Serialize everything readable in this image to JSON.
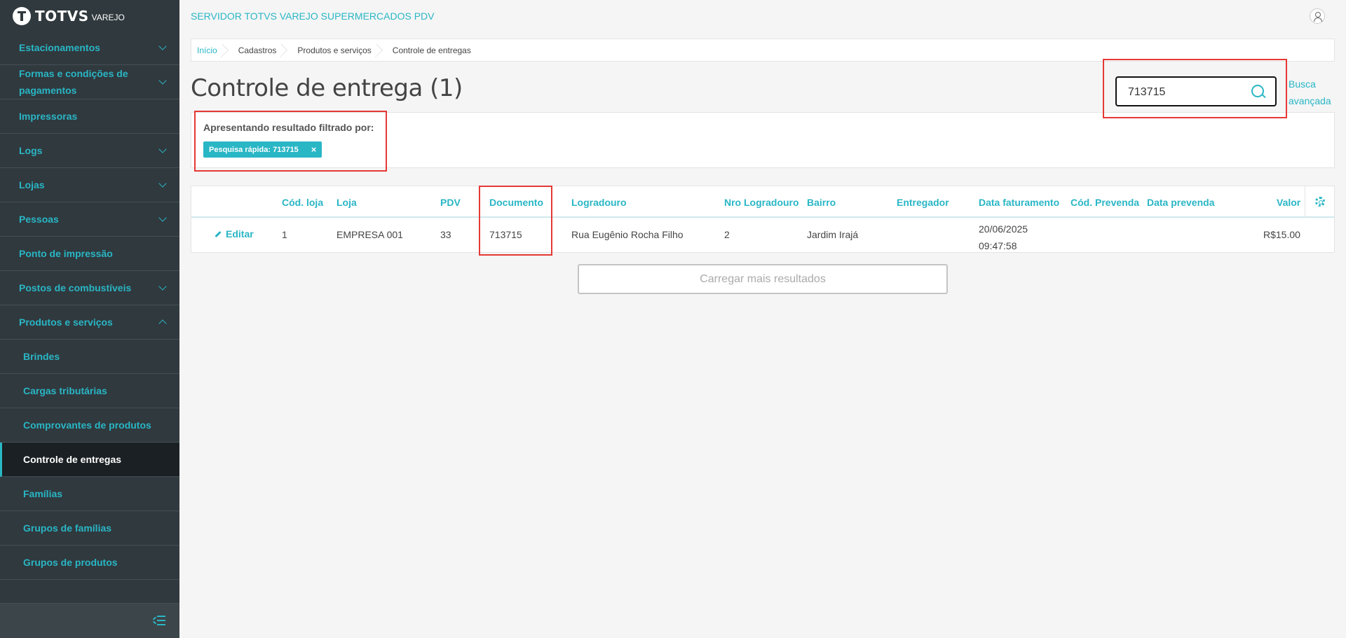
{
  "brand": {
    "name": "TOTVS",
    "sub": "VAREJO"
  },
  "header": {
    "server_title": "SERVIDOR TOTVS VAREJO SUPERMERCADOS PDV"
  },
  "sidebar": {
    "items": [
      {
        "label": "Estacionamentos",
        "expandable": true
      },
      {
        "label": "Formas e condições de pagamentos",
        "line1": "Formas e condições de",
        "line2": "pagamentos",
        "expandable": true
      },
      {
        "label": "Impressoras",
        "expandable": false
      },
      {
        "label": "Logs",
        "expandable": true
      },
      {
        "label": "Lojas",
        "expandable": true
      },
      {
        "label": "Pessoas",
        "expandable": true
      },
      {
        "label": "Ponto de impressão",
        "expandable": false
      },
      {
        "label": "Postos de combustíveis",
        "expandable": true
      },
      {
        "label": "Produtos e serviços",
        "expandable": true,
        "expanded": true
      }
    ],
    "sub_items": [
      {
        "label": "Brindes"
      },
      {
        "label": "Cargas tributárias"
      },
      {
        "label": "Comprovantes de produtos"
      },
      {
        "label": "Controle de entregas",
        "active": true
      },
      {
        "label": "Famílias"
      },
      {
        "label": "Grupos de famílias"
      },
      {
        "label": "Grupos de produtos"
      }
    ]
  },
  "breadcrumb": [
    "Início",
    "Cadastros",
    "Produtos e serviços",
    "Controle de entregas"
  ],
  "page": {
    "title": "Controle de entrega (1)"
  },
  "search": {
    "value": "713715",
    "advanced_line1": "Busca",
    "advanced_line2": "avançada"
  },
  "filter": {
    "label": "Apresentando resultado filtrado por:",
    "chip": "Pesquisa rápida: 713715",
    "chip_close": "×"
  },
  "table": {
    "columns": [
      "Cód. loja",
      "Loja",
      "PDV",
      "Documento",
      "Logradouro",
      "Nro Logradouro",
      "Bairro",
      "Entregador",
      "Data faturamento",
      "Cód. Prevenda",
      "Data prevenda",
      "Valor"
    ],
    "rows": [
      {
        "action": "Editar",
        "cod_loja": "1",
        "loja": "EMPRESA 001",
        "pdv": "33",
        "documento": "713715",
        "logradouro": "Rua Eugênio Rocha Filho",
        "nro": "2",
        "bairro": "Jardim Irajá",
        "entregador": "",
        "data_fat_date": "20/06/2025",
        "data_fat_time": "09:47:58",
        "cod_prevenda": "",
        "data_prevenda": "",
        "valor": "R$15.00"
      }
    ]
  },
  "load_more": {
    "label": "Carregar mais resultados"
  },
  "colors": {
    "accent": "#29b6c5",
    "sidebar_bg": "#30393e",
    "highlight": "#e53935"
  }
}
